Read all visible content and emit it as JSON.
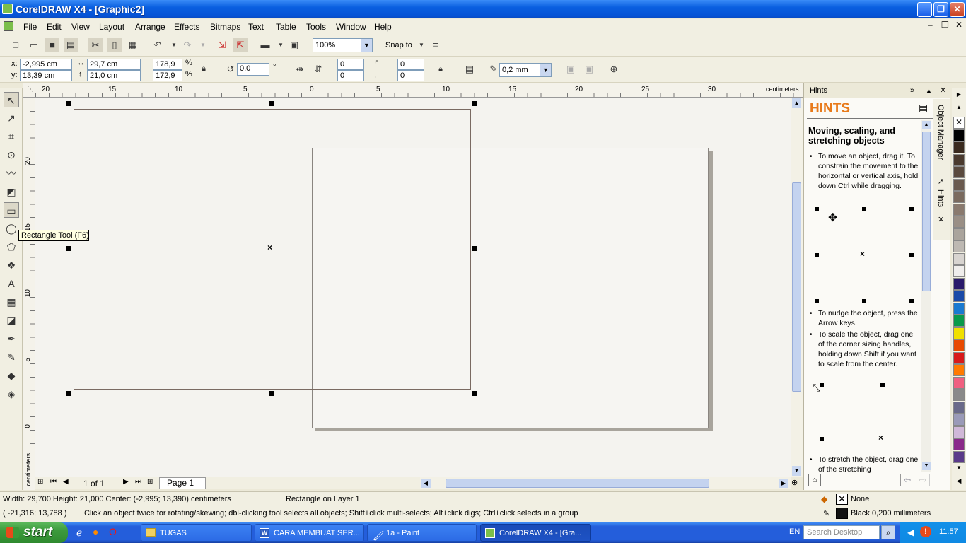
{
  "window": {
    "title": "CorelDRAW X4 - [Graphic2]"
  },
  "menu": [
    "File",
    "Edit",
    "View",
    "Layout",
    "Arrange",
    "Effects",
    "Bitmaps",
    "Text",
    "Table",
    "Tools",
    "Window",
    "Help"
  ],
  "standard_toolbar": {
    "zoom": "100%",
    "snap_to": "Snap to"
  },
  "property_bar": {
    "x": "-2,995 cm",
    "y": "13,39 cm",
    "width": "29,7 cm",
    "height": "21,0 cm",
    "scale_w": "178,9",
    "scale_h": "172,9",
    "percent": "%",
    "rotation": "0,0",
    "degree": "°",
    "corner1": "0",
    "corner2": "0",
    "corner3": "0",
    "corner4": "0",
    "outline_width": "0,2 mm"
  },
  "tooltip": "Rectangle Tool (F6)",
  "ruler": {
    "units": "centimeters",
    "h_labels": [
      "20",
      "15",
      "10",
      "5",
      "0",
      "5",
      "10",
      "15",
      "20",
      "25",
      "30"
    ],
    "v_labels": [
      "20",
      "15",
      "10",
      "5",
      "0"
    ],
    "v_units": "centimeters"
  },
  "page_nav": {
    "count": "1 of 1",
    "tab": "Page 1"
  },
  "hints": {
    "panel_title": "Hints",
    "heading": "HINTS",
    "subheading": "Moving, scaling, and stretching objects",
    "p1": "To move an object, drag it. To constrain the movement to the horizontal or vertical axis, hold down Ctrl while dragging.",
    "p2": "To nudge the object, press the Arrow keys.",
    "p3": "To scale the object, drag one of the corner sizing handles, holding down Shift if you want to scale from the center.",
    "p4": "To stretch the object, drag one of the stretching",
    "tab_object_manager": "Object Manager",
    "tab_hints": "Hints"
  },
  "status": {
    "dims": "Width: 29,700  Height: 21,000  Center: (-2,995; 13,390)  centimeters",
    "layer": "Rectangle on Layer 1",
    "coords": "( -21,316; 13,788 )",
    "message": "Click an object twice for rotating/skewing; dbl-clicking tool selects all objects; Shift+click multi-selects; Alt+click digs; Ctrl+click selects in a group",
    "fill": "None",
    "outline": "Black  0,200 millimeters"
  },
  "taskbar": {
    "start": "start",
    "tasks": [
      "TUGAS",
      "CARA MEMBUAT SER...",
      "1a - Paint",
      "CorelDRAW X4 - [Gra..."
    ],
    "lang": "EN",
    "search_placeholder": "Search Desktop",
    "clock": "11:57"
  },
  "palette_colors": [
    "#ffffff",
    "#000000",
    "#3a2a1e",
    "#4a3a2e",
    "#5a4a3e",
    "#6a5a4e",
    "#7a6a5e",
    "#8a7a6e",
    "#9a8f85",
    "#aaa49c",
    "#bdb8b2",
    "#d8d4d0",
    "#f0eeec",
    "#2a1a6a",
    "#1a4aa8",
    "#1a7ad0",
    "#0a9a4a",
    "#f0e000",
    "#e84a00",
    "#d81a1a",
    "#ff7a00",
    "#f06080",
    "#8a8a8a",
    "#6a6a8a",
    "#9a9ab8",
    "#d0b8d8",
    "#8a2a8a",
    "#5a3a8a"
  ]
}
